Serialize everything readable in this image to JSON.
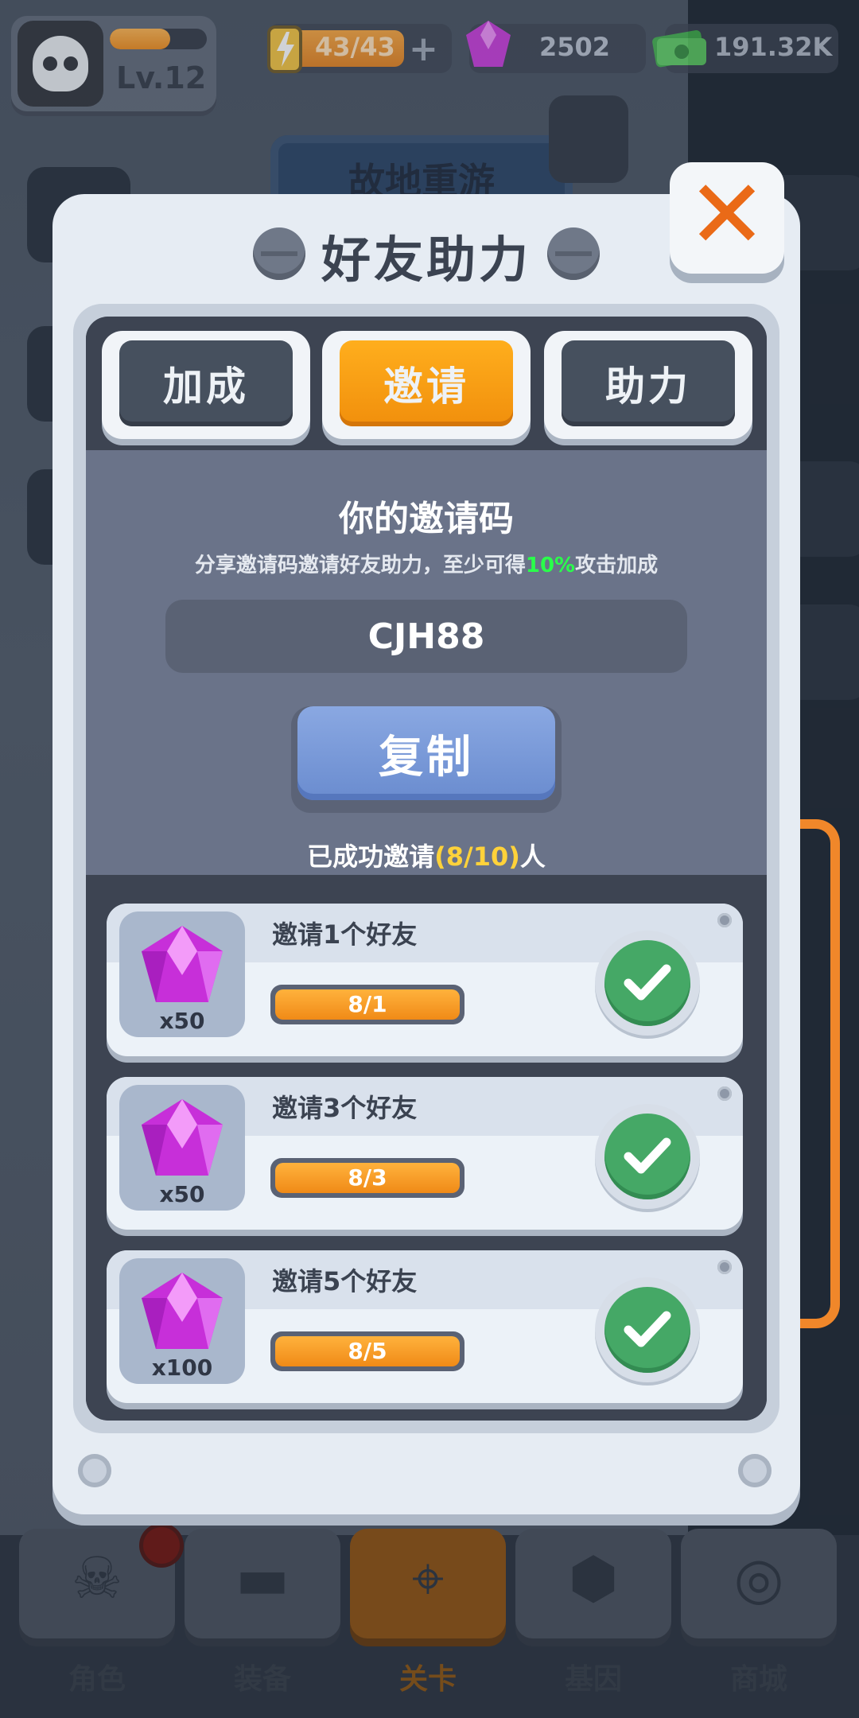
{
  "hud": {
    "level": "Lv.12",
    "xp_progress": 0.62,
    "energy": "43/43",
    "gems": "2502",
    "cash": "191.32K",
    "icons": [
      "skull-avatar-icon",
      "energy-battery-icon",
      "gem-icon",
      "cash-icon",
      "plus-icon"
    ]
  },
  "background": {
    "banner": "故地重游"
  },
  "dialog": {
    "title": "好友助力",
    "close_label": "✕",
    "tabs": [
      {
        "label": "加成",
        "active": false
      },
      {
        "label": "邀请",
        "active": true
      },
      {
        "label": "助力",
        "active": false
      }
    ],
    "invite": {
      "title": "你的邀请码",
      "subtitle_before": "分享邀请码邀请好友助力，至少可得",
      "subtitle_highlight": "10%",
      "subtitle_after": "攻击加成",
      "code": "CJH88",
      "copy_label": "复制",
      "count_before": "已成功邀请",
      "count_highlight": "(8/10)",
      "count_after": "人"
    },
    "rewards": [
      {
        "label": "邀请1个好友",
        "gem_count": "x50",
        "progress_text": "8/1",
        "progress": 1.0,
        "claimed": true
      },
      {
        "label": "邀请3个好友",
        "gem_count": "x50",
        "progress_text": "8/3",
        "progress": 1.0,
        "claimed": true
      },
      {
        "label": "邀请5个好友",
        "gem_count": "x100",
        "progress_text": "8/5",
        "progress": 1.0,
        "claimed": true
      }
    ]
  },
  "nav": [
    {
      "label": "角色",
      "icon": "skull-icon",
      "active": false,
      "badge": true
    },
    {
      "label": "装备",
      "icon": "gun-icon",
      "active": false,
      "badge": false
    },
    {
      "label": "关卡",
      "icon": "map-pin-icon",
      "active": true,
      "badge": false
    },
    {
      "label": "基因",
      "icon": "hexagon-cluster-icon",
      "active": false,
      "badge": false
    },
    {
      "label": "商城",
      "icon": "shop-icon",
      "active": false,
      "badge": false
    }
  ],
  "colors": {
    "accent_orange": "#f18f0c",
    "success_green": "#45a866",
    "highlight_green": "#2aff4b",
    "highlight_yellow": "#ffd23a",
    "close_orange": "#ea6a17"
  }
}
